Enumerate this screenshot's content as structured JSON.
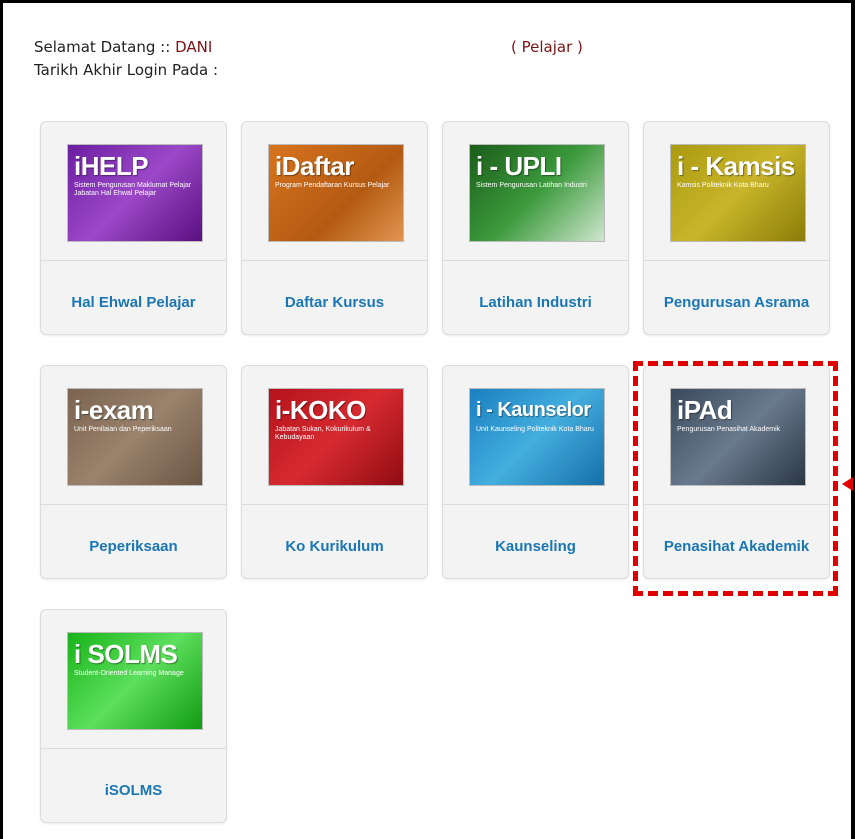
{
  "header": {
    "welcome_label": "Selamat Datang :: ",
    "user_name": "DANI",
    "role": "( Pelajar )",
    "last_login_label": "Tarikh Akhir Login Pada :"
  },
  "apps": [
    {
      "label": "Hal Ehwal Pelajar",
      "logo": "iHELP",
      "subtitle": "Sistem Pengurusan Maklumat Pelajar Jabatan Hal Ehwal Pelajar"
    },
    {
      "label": "Daftar Kursus",
      "logo": "iDaftar",
      "subtitle": "Program Pendaftaran Kursus Pelajar"
    },
    {
      "label": "Latihan Industri",
      "logo": "i - UPLI",
      "subtitle": "Sistem Pengurusan Latihan Industri"
    },
    {
      "label": "Pengurusan Asrama",
      "logo": "i - Kamsis",
      "subtitle": "Kamsis Politeknik Kota Bharu"
    },
    {
      "label": "Peperiksaan",
      "logo": "i-exam",
      "subtitle": "Unit Penilaian dan Peperiksaan"
    },
    {
      "label": "Ko Kurikulum",
      "logo": "i-KOKO",
      "subtitle": "Jabatan Sukan, Kokurikulum & Kebudayaan"
    },
    {
      "label": "Kaunseling",
      "logo": "i - Kaunselor",
      "subtitle": "Unit Kaunseling Politeknik Kota Bharu"
    },
    {
      "label": "Penasihat Akademik",
      "logo": "iPAd",
      "subtitle": "Pengurusan Penasihat Akademik"
    },
    {
      "label": "iSOLMS",
      "logo": "i SOLMS",
      "subtitle": "Student-Oriented Learning Manage"
    }
  ],
  "colors": {
    "label_text": "#1b77b3",
    "highlight": "#e00000",
    "user_name": "#7a1414"
  }
}
